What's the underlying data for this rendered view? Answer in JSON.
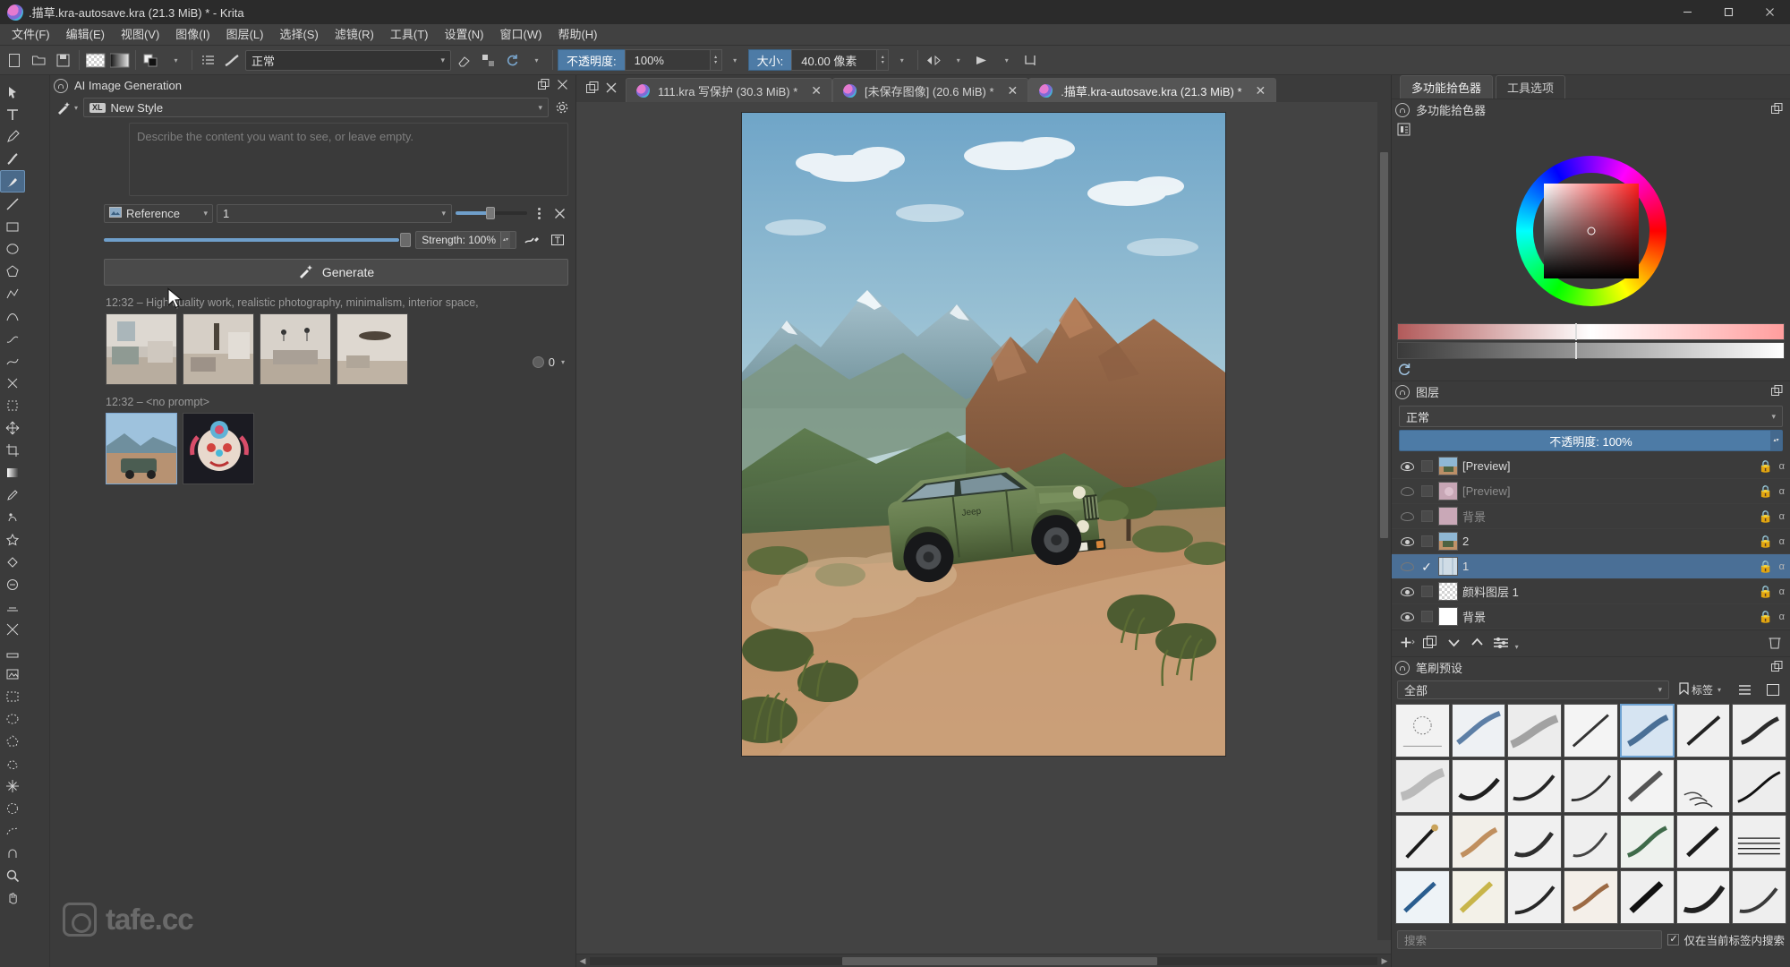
{
  "window": {
    "title": ".描草.kra-autosave.kra (21.3 MiB) * - Krita",
    "minimize": "─",
    "maximize": "□",
    "close": "✕"
  },
  "menubar": {
    "items": [
      {
        "label": "文件(F)"
      },
      {
        "label": "编辑(E)"
      },
      {
        "label": "视图(V)"
      },
      {
        "label": "图像(I)"
      },
      {
        "label": "图层(L)"
      },
      {
        "label": "选择(S)"
      },
      {
        "label": "滤镜(R)"
      },
      {
        "label": "工具(T)"
      },
      {
        "label": "设置(N)"
      },
      {
        "label": "窗口(W)"
      },
      {
        "label": "帮助(H)"
      }
    ]
  },
  "toolbar": {
    "blend_mode": "正常",
    "opacity_label": "不透明度:",
    "opacity_value": "100%",
    "size_label": "大小:",
    "size_value": "40.00 像素"
  },
  "ai_docker": {
    "title": "AI Image Generation",
    "style_badge": "XL",
    "style_name": "New Style",
    "prompt_placeholder": "Describe the content you want to see, or leave empty.",
    "reference_label": "Reference",
    "reference_count": "1",
    "strength_label": "Strength: 100%",
    "generate_label": "Generate",
    "seed_value": "0",
    "history": [
      {
        "label": "12:32 – High quality work, realistic photography, minimalism, interior space,"
      },
      {
        "label": "12:32 – <no prompt>"
      }
    ]
  },
  "watermark": {
    "text": "tafe.cc"
  },
  "tabs": {
    "items": [
      {
        "label": "111.kra 写保护 (30.3 MiB) *",
        "active": false,
        "closable": true
      },
      {
        "label": "[未保存图像] (20.6 MiB) *",
        "active": false,
        "closable": true
      },
      {
        "label": ".描草.kra-autosave.kra (21.3 MiB) *",
        "active": true,
        "closable": true
      }
    ]
  },
  "right_tabs": {
    "items": [
      {
        "label": "多功能拾色器",
        "active": true
      },
      {
        "label": "工具选项",
        "active": false
      }
    ]
  },
  "color_picker": {
    "title": "多功能拾色器"
  },
  "layers_docker": {
    "title": "图层",
    "blend_mode": "正常",
    "opacity_label": "不透明度: 100%",
    "rows": [
      {
        "name": "[Preview]",
        "visible": true,
        "selected": false,
        "dim": false,
        "alpha": "α"
      },
      {
        "name": "[Preview]",
        "visible": false,
        "selected": false,
        "dim": true,
        "alpha": "α"
      },
      {
        "name": "背景",
        "visible": false,
        "selected": false,
        "dim": true,
        "alpha": "α"
      },
      {
        "name": "2",
        "visible": true,
        "selected": false,
        "dim": false,
        "alpha": "α"
      },
      {
        "name": "1",
        "visible": false,
        "selected": true,
        "dim": false,
        "alpha": "α"
      },
      {
        "name": "颜料图层 1",
        "visible": true,
        "selected": false,
        "dim": false,
        "alpha": "α"
      },
      {
        "name": "背景",
        "visible": true,
        "selected": false,
        "dim": false,
        "alpha": "α"
      }
    ]
  },
  "brush_presets": {
    "title": "笔刷预设",
    "filter_value": "全部",
    "tag_label": "标签",
    "search_placeholder": "搜索",
    "scope_label": "仅在当前标签内搜索",
    "scope_checked": true,
    "selected_index": 4,
    "count": 28
  }
}
